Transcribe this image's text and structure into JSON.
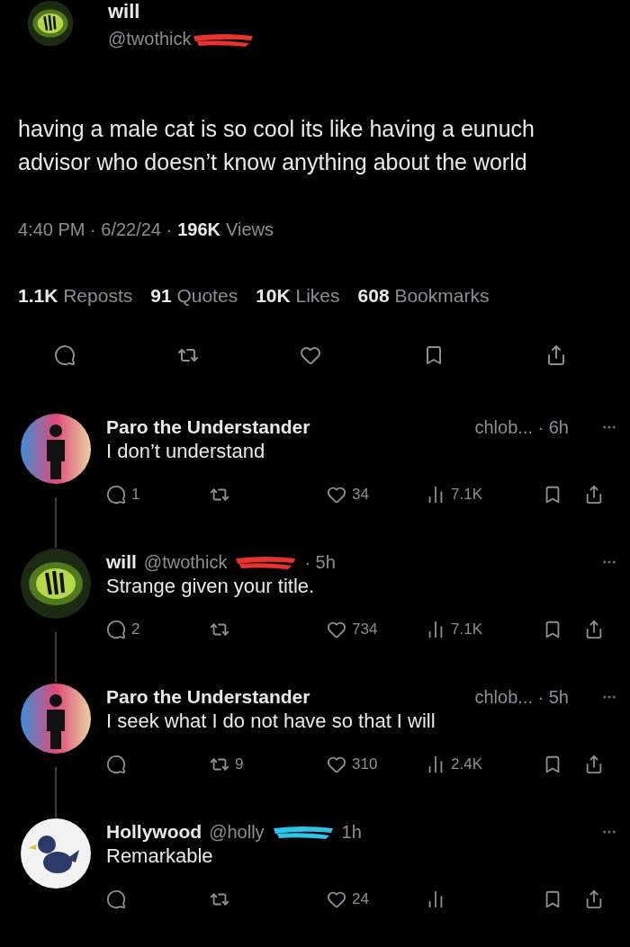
{
  "tweet": {
    "author": {
      "name": "will",
      "handle": "@twothick",
      "avatar": {
        "kind": "eye"
      },
      "redaction": {
        "color": "#e8342c"
      }
    },
    "text": "having a male cat is so cool its like having a eunuch advisor who doesn’t know anything about the world",
    "timestamp": "4:40 PM · 6/22/24 ·",
    "views": {
      "value": "196K",
      "label": "Views"
    },
    "stats": [
      "**1.1K** Reposts",
      "**91** Quotes",
      "**10K** Likes",
      "**608** Bookmarks"
    ]
  },
  "replies": [
    {
      "kind": "right_handle",
      "name": "Paro the Understander",
      "handle": "chlob... · 6h",
      "avatar": {
        "kind": "figure"
      },
      "text": "I don’t understand",
      "reply_count": "1",
      "likes": "34",
      "views": "7.1K"
    },
    {
      "kind": "inline_handle",
      "name": "will",
      "handle": "@twothick",
      "redaction": {
        "color": "#e8342c"
      },
      "time": "· 5h",
      "avatar": {
        "kind": "eye"
      },
      "text": "Strange given your title.",
      "reply_count": "2",
      "likes": "734",
      "views": "7.1K"
    },
    {
      "kind": "right_handle",
      "name": "Paro the Understander",
      "handle": "chlob... · 5h",
      "avatar": {
        "kind": "figure"
      },
      "text": "I seek what I do not have so that I will",
      "reposts": "9",
      "likes": "310",
      "views": "2.4K"
    },
    {
      "kind": "inline_handle",
      "name": "Hollywood",
      "handle": "@holly",
      "redaction": {
        "color": "#2ec4ea"
      },
      "time": "1h",
      "avatar": {
        "kind": "bird"
      },
      "text": "Remarkable",
      "likes": "24"
    }
  ]
}
